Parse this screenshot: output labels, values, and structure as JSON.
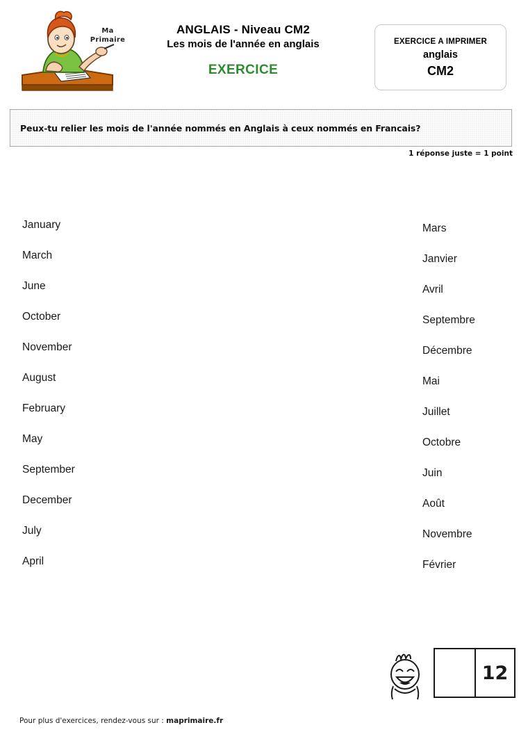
{
  "header": {
    "logo_wordmark_line1": "Ma",
    "logo_wordmark_line2": "Primaire",
    "title_line1": "ANGLAIS  -  Niveau CM2",
    "title_line2": "Les mois de l'année en anglais",
    "exercice_label": "EXERCICE",
    "exercice_color": "#2e8b2e",
    "badge": {
      "line1": "EXERCICE A IMPRIMER",
      "line2": "anglais",
      "line3": "CM2"
    }
  },
  "instruction": {
    "text": "Peux-tu relier les mois de l'année nommés en Anglais à ceux nommés en Francais?",
    "points_note": "1 réponse juste = 1 point"
  },
  "exercise": {
    "english_months": [
      "January",
      "March",
      "June",
      "October",
      "November",
      "August",
      "February",
      "May",
      "September",
      "December",
      "July",
      "April"
    ],
    "french_months": [
      "Mars",
      "Janvier",
      "Avril",
      "Septembre",
      "Décembre",
      "Mai",
      "Juillet",
      "Octobre",
      "Juin",
      "Août",
      "Novembre",
      "Février"
    ]
  },
  "footer": {
    "note_prefix": "Pour plus d'exercices, rendez-vous sur : ",
    "site": "maprimaire.fr",
    "score_blank": "",
    "score_total": "12"
  }
}
